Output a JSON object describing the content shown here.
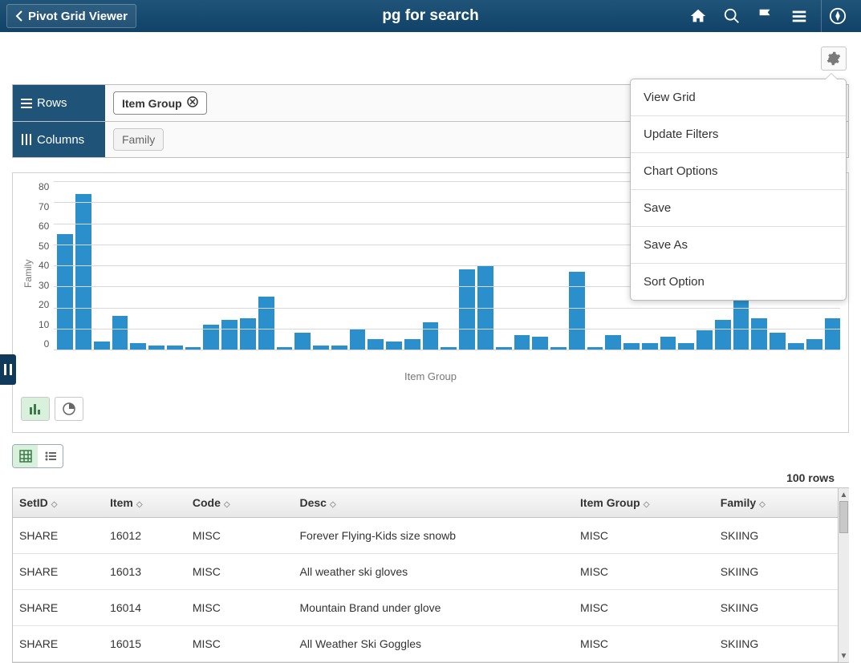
{
  "header": {
    "back_label": "Pivot Grid Viewer",
    "title": "pg for search"
  },
  "menu": {
    "items": [
      "View Grid",
      "Update Filters",
      "Chart Options",
      "Save",
      "Save As",
      "Sort Option"
    ]
  },
  "pivot": {
    "rows_label": "Rows",
    "columns_label": "Columns",
    "row_chip": "Item Group",
    "col_chip": "Family"
  },
  "chart_data": {
    "type": "bar",
    "ylabel": "Family",
    "xlabel": "Item Group",
    "ylim": [
      0,
      80
    ],
    "yticks": [
      0,
      10,
      20,
      30,
      40,
      50,
      60,
      70,
      80
    ],
    "values": [
      55,
      74,
      4,
      16,
      3,
      2,
      2,
      1,
      12,
      14,
      15,
      25,
      1,
      8,
      2,
      2,
      10,
      5,
      4,
      5,
      13,
      1,
      38,
      40,
      1,
      7,
      6,
      1,
      37,
      1,
      7,
      3,
      3,
      6,
      3,
      9,
      14,
      67,
      15,
      8,
      3,
      5,
      15
    ]
  },
  "grid": {
    "row_count_label": "100 rows",
    "columns": [
      "SetID",
      "Item",
      "Code",
      "Desc",
      "Item Group",
      "Family"
    ],
    "rows": [
      {
        "SetID": "SHARE",
        "Item": "16012",
        "Code": "MISC",
        "Desc": "Forever Flying-Kids size snowb",
        "Item Group": "MISC",
        "Family": "SKIING"
      },
      {
        "SetID": "SHARE",
        "Item": "16013",
        "Code": "MISC",
        "Desc": "All weather ski gloves",
        "Item Group": "MISC",
        "Family": "SKIING"
      },
      {
        "SetID": "SHARE",
        "Item": "16014",
        "Code": "MISC",
        "Desc": "Mountain Brand under glove",
        "Item Group": "MISC",
        "Family": "SKIING"
      },
      {
        "SetID": "SHARE",
        "Item": "16015",
        "Code": "MISC",
        "Desc": "All Weather Ski Goggles",
        "Item Group": "MISC",
        "Family": "SKIING"
      }
    ]
  }
}
